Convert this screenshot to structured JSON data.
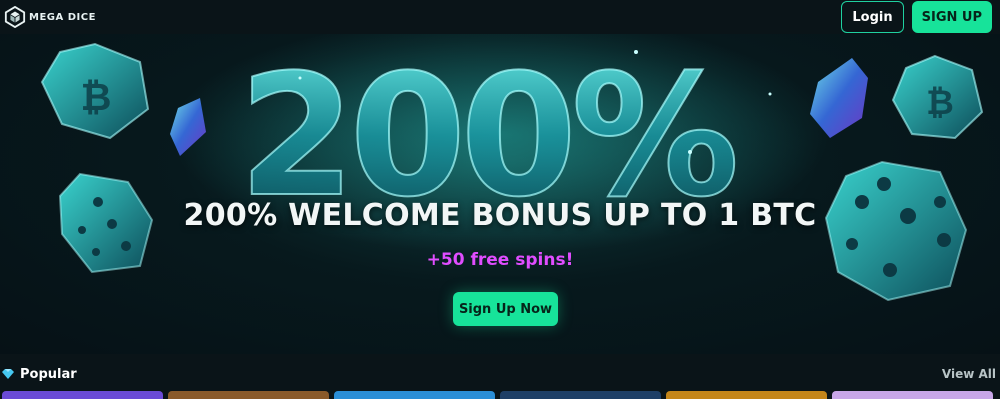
{
  "header": {
    "logo_text": "MEGA DICE",
    "login_label": "Login",
    "signup_label": "SIGN UP"
  },
  "hero": {
    "big_text": "200%",
    "headline": "200% WELCOME BONUS UP TO 1 BTC",
    "subline": "+50 free spins!",
    "cta_label": "Sign Up Now"
  },
  "popular": {
    "title": "Popular",
    "view_all_label": "View All",
    "icon": "diamond-icon"
  },
  "colors": {
    "accent": "#17e39a",
    "spins": "#e04dff",
    "background": "#0a1418"
  },
  "cards": [
    {
      "color": "#6a4bd6"
    },
    {
      "color": "#8a5a2a"
    },
    {
      "color": "#2a8ed6"
    },
    {
      "color": "#1e3f66"
    },
    {
      "color": "#c4861a"
    },
    {
      "color": "#c8a6e8"
    }
  ]
}
